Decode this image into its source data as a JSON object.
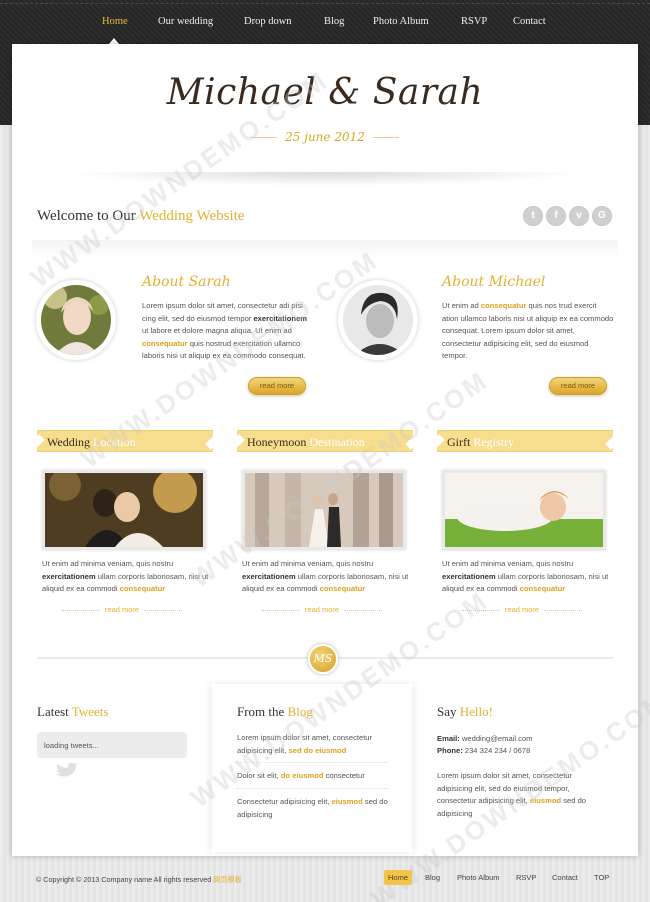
{
  "nav": {
    "items": [
      "Home",
      "Our wedding",
      "Drop down",
      "Blog",
      "Photo Album",
      "RSVP",
      "Contact"
    ],
    "active": "Home"
  },
  "header": {
    "couple": "Michael & Sarah",
    "date": "25 june 2012"
  },
  "welcome": {
    "prefix": "Welcome to Our ",
    "accent": "Wedding Website"
  },
  "social": [
    "twitter-icon",
    "facebook-icon",
    "vimeo-icon",
    "google-icon"
  ],
  "about": [
    {
      "title": "About Sarah",
      "text_a": "Lorem ipsum dolor sit amet, consectetur adi pisi cing elit, sed do eiusmod tempor ",
      "bold": "exercitationem",
      "text_b": " ut labore et dolore magna aliqua. Ut enim ad ",
      "yellow": "consequatur",
      "text_c": " quis nostrud exercitation ullamco laboris nisi ut aliquip ex ea commodo consequat.",
      "button": "read more"
    },
    {
      "title": "About Michael",
      "text_a": "Ut enim ad ",
      "yellow": "consequatur",
      "text_b": " quis nos trud exercit ation ullamco laboris nisi ut aliquip ex ea commodo consequat. Lorem ipsum dolor sit amet, consectetur adipisicing elit, sed do eiusmod tempor.",
      "button": "read more"
    }
  ],
  "cards": [
    {
      "title_dark": "Wedding",
      "title_light": " Location",
      "text_a": "Ut enim ad minima veniam, quis nostru ",
      "bold": "exercitationem",
      "text_b": " ullam corporis laboriosam, nisi ut aliquid ex ea commodi ",
      "yellow": "consequatur",
      "more": "read more"
    },
    {
      "title_dark": "Honeymoon",
      "title_light": " Destination",
      "text_a": "Ut enim ad minima veniam, quis nostru ",
      "bold": "exercitationem",
      "text_b": " ullam corporis laboriosam, nisi ut aliquid ex ea commodi ",
      "yellow": "consequatur",
      "more": "read more"
    },
    {
      "title_dark": "Girft",
      "title_light": " Registry",
      "text_a": "Ut enim ad minima veniam, quis nostru ",
      "bold": "exercitationem",
      "text_b": " ullam corporis laboriosam, nisi ut aliquid ex ea commodi ",
      "yellow": "consequatur",
      "more": "read more"
    }
  ],
  "badge": "MS",
  "tweets": {
    "title_dark": "Latest ",
    "title_light": "Tweets",
    "loading": "loading tweets..."
  },
  "blog": {
    "title_dark": "From the ",
    "title_light": "Blog",
    "items": [
      {
        "a": "Lorem ipsum dolor sit amet, consectetur adipisicing elit, ",
        "y": "sed do eiusmod",
        "b": ""
      },
      {
        "a": "Dolor sit elit, ",
        "y": "do eiusmod",
        "b": " consectetur"
      },
      {
        "a": "Consectetur adipisicing elit, ",
        "y": "eiusmod",
        "b": " sed do adipisicing"
      }
    ]
  },
  "contact": {
    "title_dark": "Say ",
    "title_light": "Hello!",
    "email_label": "Email:",
    "email": " wedding@email.com",
    "phone_label": "Phone:",
    "phone": " 234 324 234 / 0678",
    "text_a": "Lorem ipsum dolor sit amet, consectetur adipisicing elit, sed do eiusmod tempor, consectetur adipisicing elit, ",
    "yellow": "eiusmod",
    "text_b": " sed do adipisicing"
  },
  "footer": {
    "copyright": "© Copyright © 2013 Company name All rights reserved ",
    "copyright_link": "网页模板",
    "nav": [
      "Home",
      "Blog",
      "Photo Album",
      "RSVP",
      "Contact",
      "TOP"
    ],
    "active": "Home"
  },
  "watermark": "WWW.DOWNDEMO.COM",
  "colors": {
    "accent": "#e3b032",
    "dark": "#2b2b2b",
    "page": "#ffffff"
  }
}
